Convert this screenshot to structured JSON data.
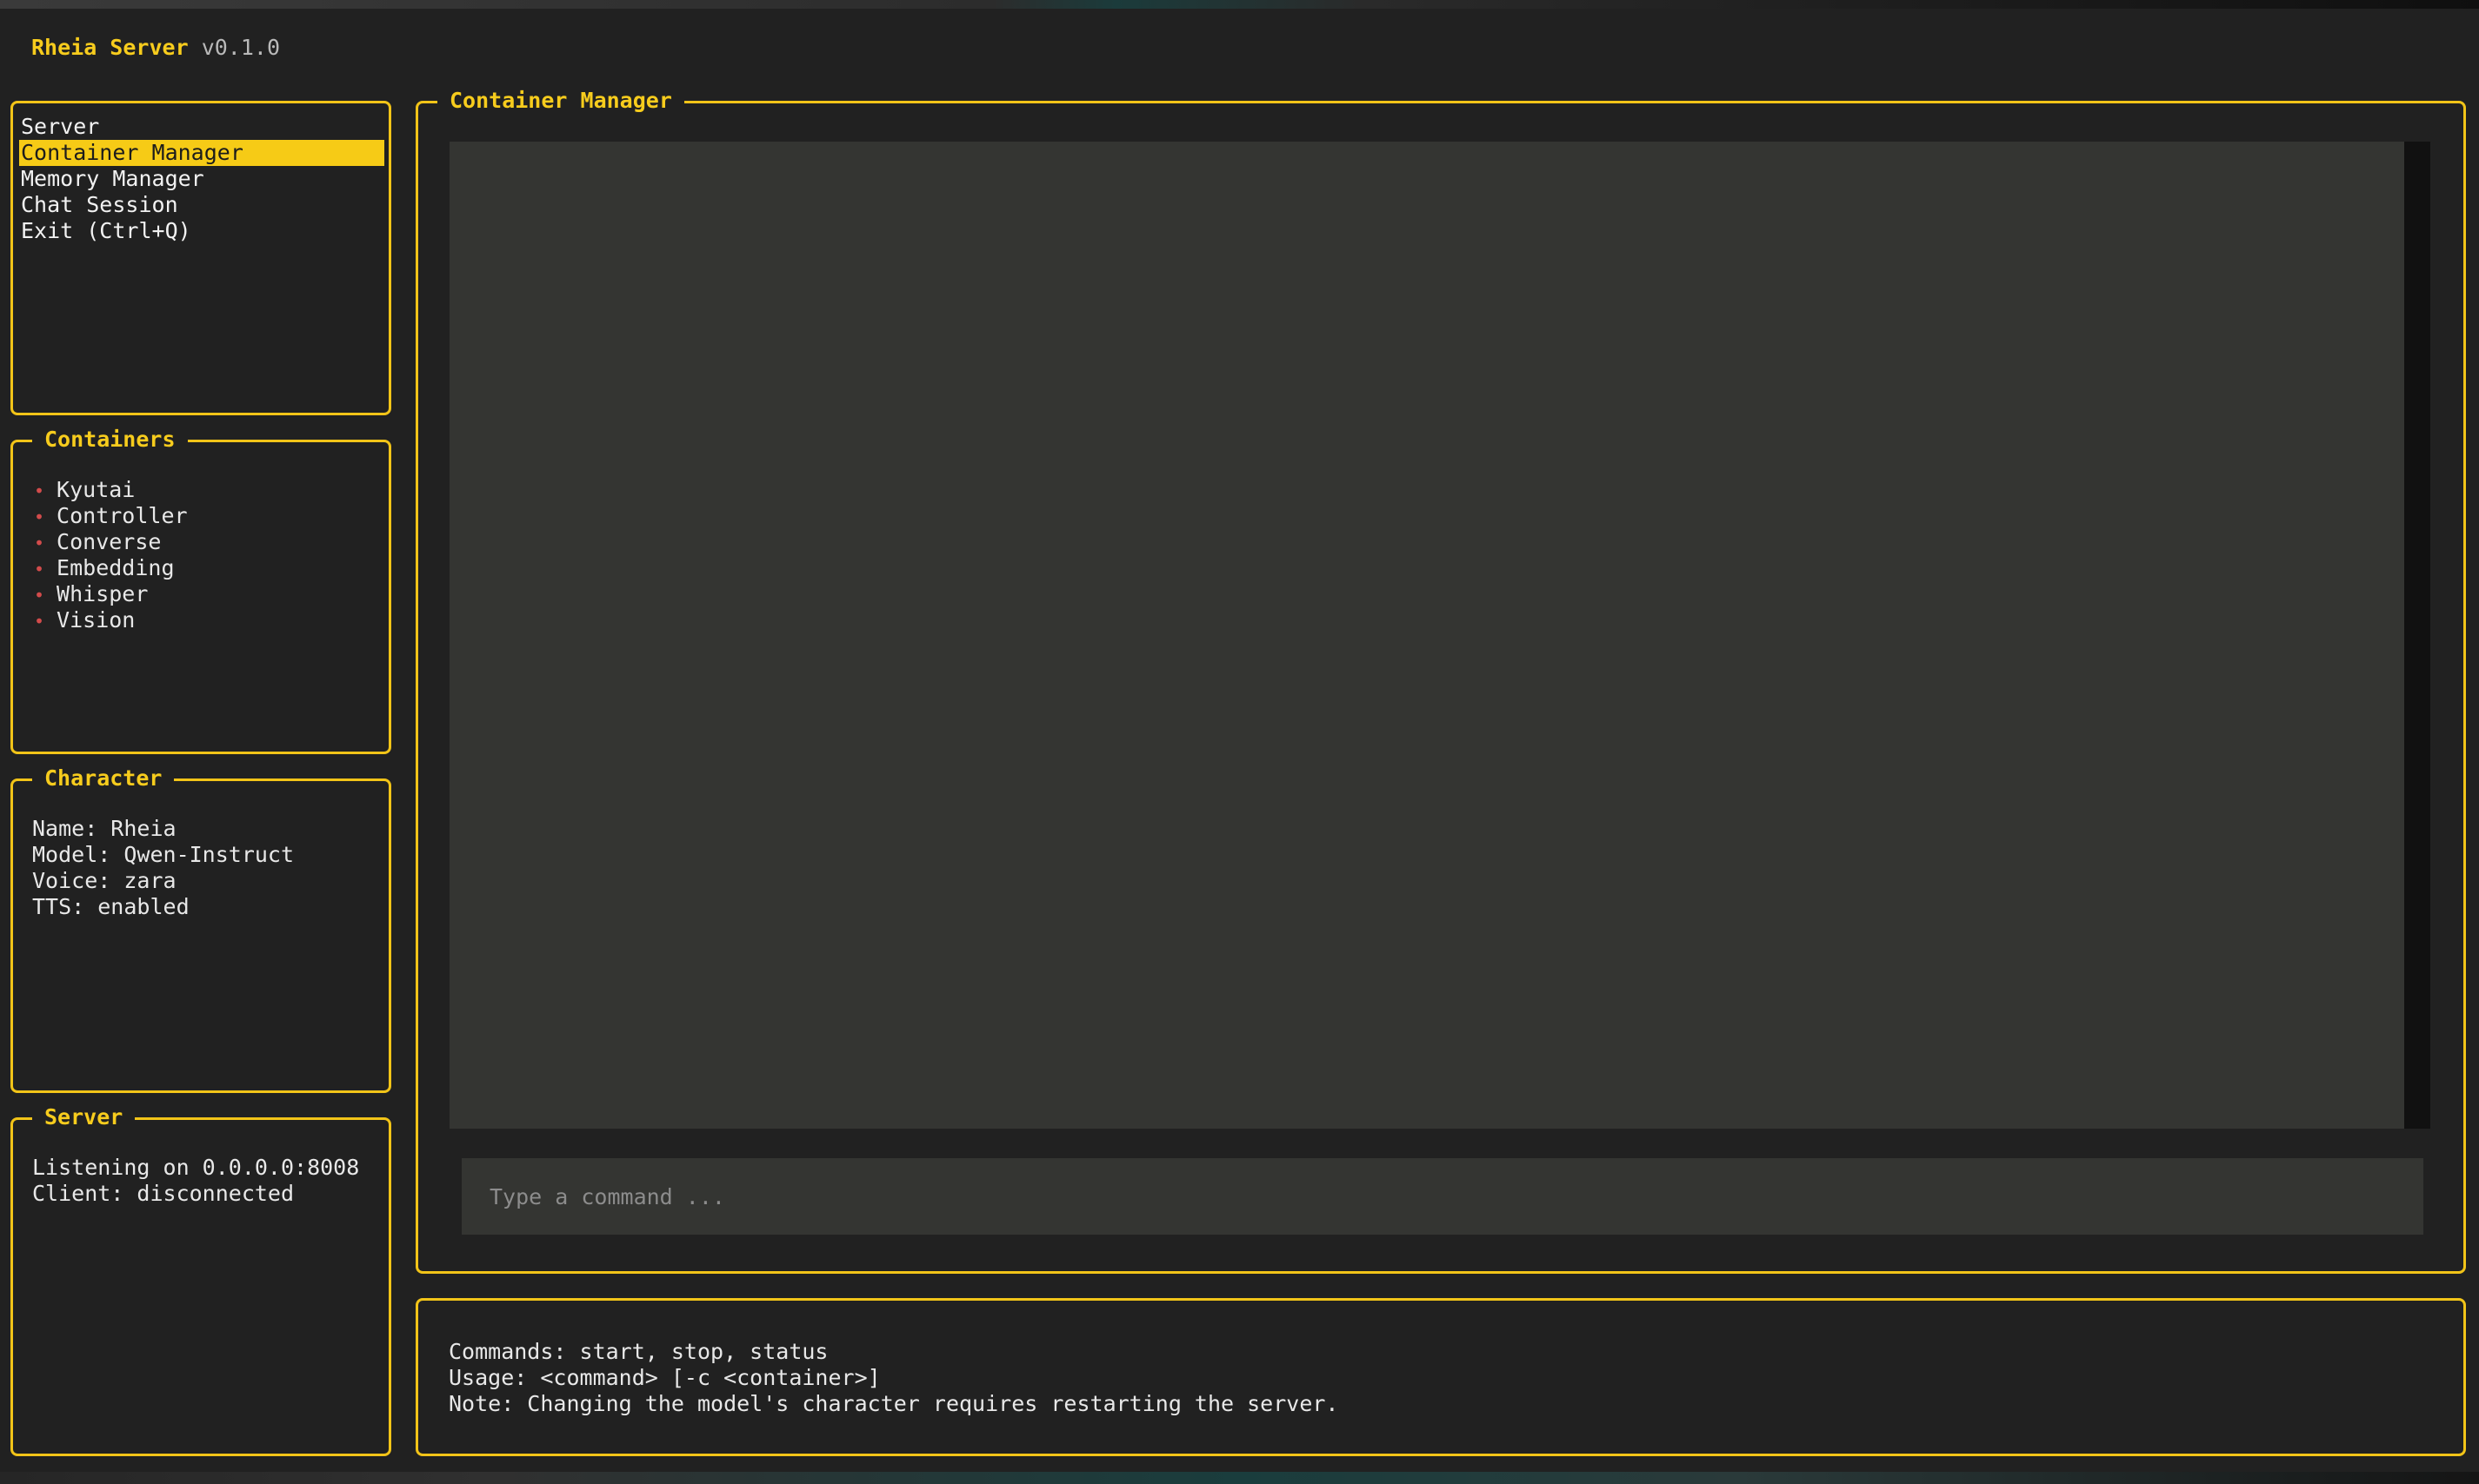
{
  "app": {
    "name": "Rheia Server",
    "version": "v0.1.0"
  },
  "nav": {
    "items": [
      {
        "label": "Server",
        "selected": false
      },
      {
        "label": "Container Manager",
        "selected": true
      },
      {
        "label": "Memory Manager",
        "selected": false
      },
      {
        "label": "Chat Session",
        "selected": false
      },
      {
        "label": "Exit (Ctrl+Q)",
        "selected": false
      }
    ]
  },
  "containers": {
    "title": "Containers",
    "bullet": "•",
    "bullet_color": "#d24b4b",
    "items": [
      "Kyutai",
      "Controller",
      "Converse",
      "Embedding",
      "Whisper",
      "Vision"
    ]
  },
  "character": {
    "title": "Character",
    "lines": [
      "Name: Rheia",
      "Model: Qwen-Instruct",
      "Voice: zara",
      "TTS: enabled"
    ]
  },
  "server": {
    "title": "Server",
    "lines": [
      "Listening on 0.0.0.0:8008",
      "Client: disconnected"
    ]
  },
  "main": {
    "title": "Container Manager",
    "command_placeholder": "Type a command ..."
  },
  "help": {
    "lines": [
      "Commands: start, stop, status",
      "Usage: <command> [-c <container>]",
      "Note: Changing the model's character requires restarting the server."
    ]
  },
  "theme": {
    "accent": "#f2c418",
    "background": "#212121",
    "output_background": "#343532"
  }
}
